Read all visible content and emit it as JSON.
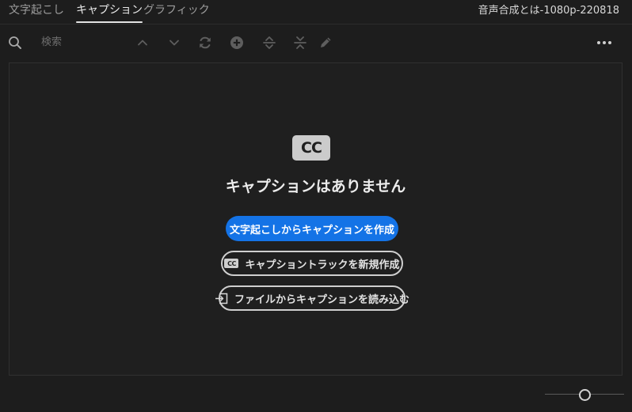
{
  "tabs": [
    {
      "label": "文字起こし",
      "active": false
    },
    {
      "label": "キャプション",
      "active": true
    },
    {
      "label": "グラフィック",
      "active": false
    }
  ],
  "sequence_name": "音声合成とは-1080p-220818",
  "toolbar": {
    "search_placeholder": "検索",
    "icons": [
      "search-icon",
      "chevron-up-icon",
      "chevron-down-icon",
      "refresh-icon",
      "add-circle-icon",
      "split-icon",
      "merge-icon",
      "pencil-icon",
      "more-icon"
    ]
  },
  "empty_state": {
    "logo_text": "CC",
    "title": "キャプションはありません",
    "create_from_transcript": "文字起こしからキャプションを作成",
    "new_track_icon_text": "CC",
    "new_track": "キャプショントラックを新規作成",
    "import_file": "ファイルからキャプションを読み込む"
  },
  "colors": {
    "background": "#1d1d1d",
    "accent": "#1473e6",
    "text": "#e8e8e8"
  }
}
